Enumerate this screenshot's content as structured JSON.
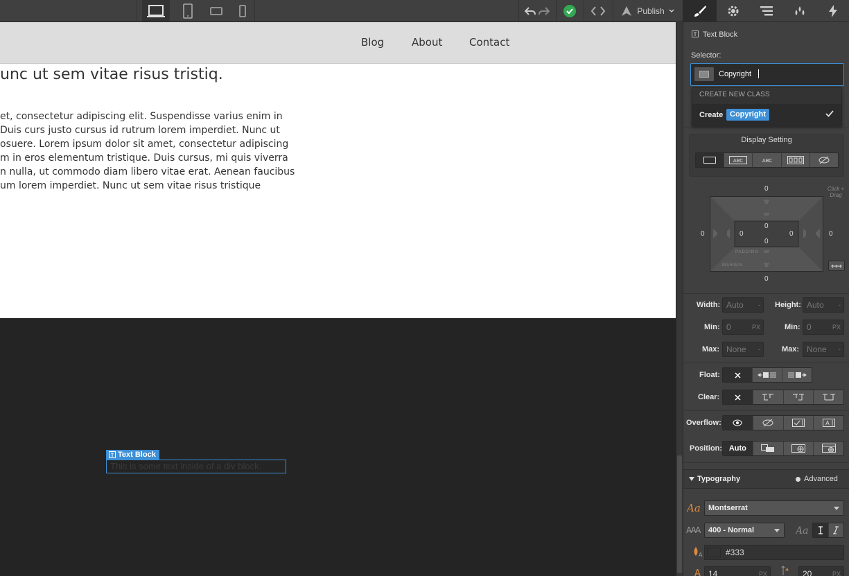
{
  "topbar": {
    "publish_label": "Publish"
  },
  "site": {
    "nav": [
      "Blog",
      "About",
      "Contact"
    ],
    "heading": "unc ut sem vitae risus tristiq.",
    "paragraph_lines": [
      "et, consectetur adipiscing elit. Suspendisse varius enim in",
      "Duis curs justo cursus id rutrum lorem imperdiet. Nunc ut",
      "osuere. Lorem ipsum dolor sit amet, consectetur adipiscing",
      "m in eros elementum tristique. Duis cursus, mi quis viverra",
      "n nulla, ut commodo diam libero vitae erat. Aenean faucibus",
      "um lorem imperdiet. Nunc ut sem vitae risus tristique"
    ]
  },
  "selected_element": {
    "label": "Text Block",
    "text": "This is some text inside of a div block."
  },
  "panel": {
    "element_type": "Text Block",
    "selector_label": "Selector:",
    "selector_value": "Copyright",
    "dropdown": {
      "header": "CREATE NEW CLASS",
      "create_label": "Create",
      "create_class": "Copyright"
    },
    "display_setting_label": "Display Setting",
    "box_model": {
      "margin_top": "0",
      "margin_bottom": "0",
      "margin_left": "0",
      "margin_right": "0",
      "padding_top": "0",
      "padding_bottom": "0",
      "padding_left": "0",
      "padding_right": "0",
      "padding_label": "PADDING",
      "margin_label": "MARGIN",
      "hint": "Click + Drag"
    },
    "size": {
      "width_label": "Width:",
      "width_value": "Auto",
      "height_label": "Height:",
      "height_value": "Auto",
      "min_label": "Min:",
      "min_w": "0",
      "min_h": "0",
      "max_label": "Max:",
      "max_w": "None",
      "max_h": "None",
      "unit_px": "PX",
      "dash": "-"
    },
    "float_label": "Float:",
    "clear_label": "Clear:",
    "overflow_label": "Overflow:",
    "position_label": "Position:",
    "position_value": "Auto",
    "typography_label": "Typography",
    "advanced_label": "Advanced",
    "font_family": "Montserrat",
    "font_weight": "400 - Normal",
    "color_value": "#333",
    "font_size": "14",
    "line_height": "20"
  },
  "colors": {
    "accent": "#3d8fd6",
    "success": "#34a853",
    "panel_bg": "#404040",
    "canvas_bg": "#242424"
  }
}
